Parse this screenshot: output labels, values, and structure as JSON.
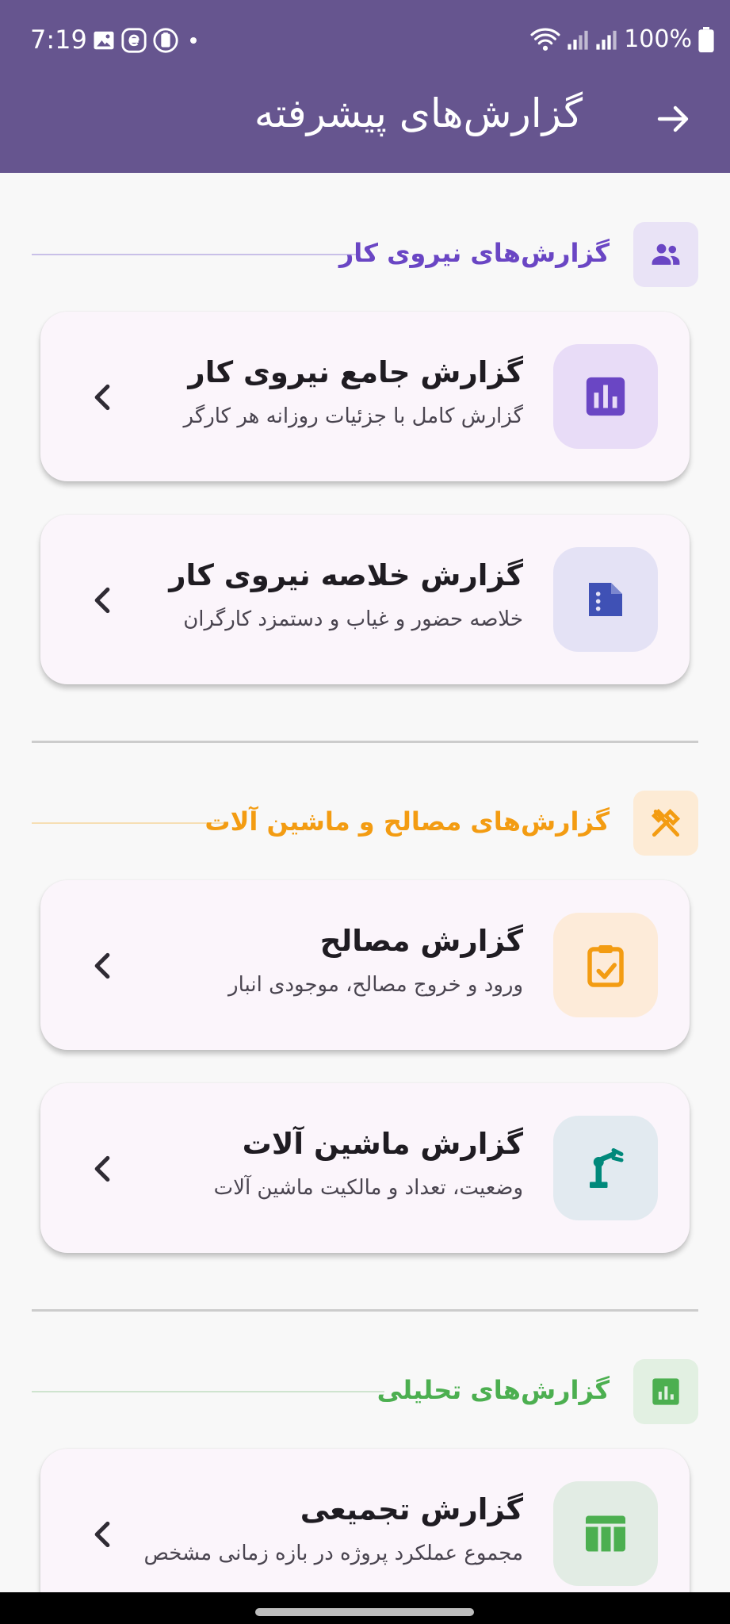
{
  "status_bar": {
    "time": "7:19",
    "battery": "100%",
    "icons_left": [
      "image-notification-icon",
      "app-e-icon",
      "clipboard-notification-icon",
      "dot-icon"
    ],
    "icons_right": [
      "wifi-icon",
      "signal-icon",
      "signal-icon",
      "battery-icon"
    ]
  },
  "appbar": {
    "title": "گزارش‌های پیشرفته",
    "back_icon": "arrow-right-icon",
    "color": "#66558f"
  },
  "sections": [
    {
      "title": "گزارش‌های نیروی کار",
      "icon": "people-icon",
      "color": "#6a46c4",
      "cards": [
        {
          "title": "گزارش جامع نیروی کار",
          "subtitle": "گزارش کامل با جزئیات روزانه هر کارگر",
          "icon": "bar-chart-icon"
        },
        {
          "title": "گزارش خلاصه نیروی کار",
          "subtitle": "خلاصه حضور و غیاب و دستمزد کارگران",
          "icon": "document-list-icon"
        }
      ]
    },
    {
      "title": "گزارش‌های مصالح و ماشین آلات",
      "icon": "tools-icon",
      "color": "#f39c12",
      "cards": [
        {
          "title": "گزارش مصالح",
          "subtitle": "ورود و خروج مصالح، موجودی انبار",
          "icon": "clipboard-check-icon"
        },
        {
          "title": "گزارش ماشین آلات",
          "subtitle": "وضعیت، تعداد و مالکیت ماشین آلات",
          "icon": "robot-arm-icon"
        }
      ]
    },
    {
      "title": "گزارش‌های تحلیلی",
      "icon": "analytics-icon",
      "color": "#4caf50",
      "cards": [
        {
          "title": "گزارش تجمیعی",
          "subtitle": "مجموع عملکرد پروژه در بازه زمانی مشخص",
          "icon": "table-icon"
        }
      ]
    }
  ]
}
